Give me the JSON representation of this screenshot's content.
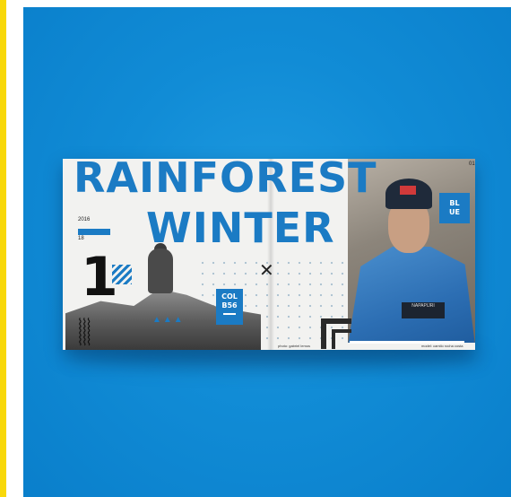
{
  "magazine": {
    "headline_top": "RAINFOREST",
    "headline_bottom": "WINTER",
    "year": "2016",
    "issue": "18",
    "collection_tag": "COL B56",
    "collection_line1": "COL",
    "collection_line2": "B56",
    "color_tag_line1": "BL",
    "color_tag_line2": "UE",
    "big_number": "1",
    "page_number": "01",
    "folio_left": "photo: gabriel lemos",
    "folio_right": "model: camilo rocha costa",
    "chest_patch_text": "NAPAPIJRI"
  },
  "colors": {
    "background_blue": "#118cd6",
    "accent_blue": "#1b7bc4",
    "edge_yellow": "#f8d80a"
  }
}
